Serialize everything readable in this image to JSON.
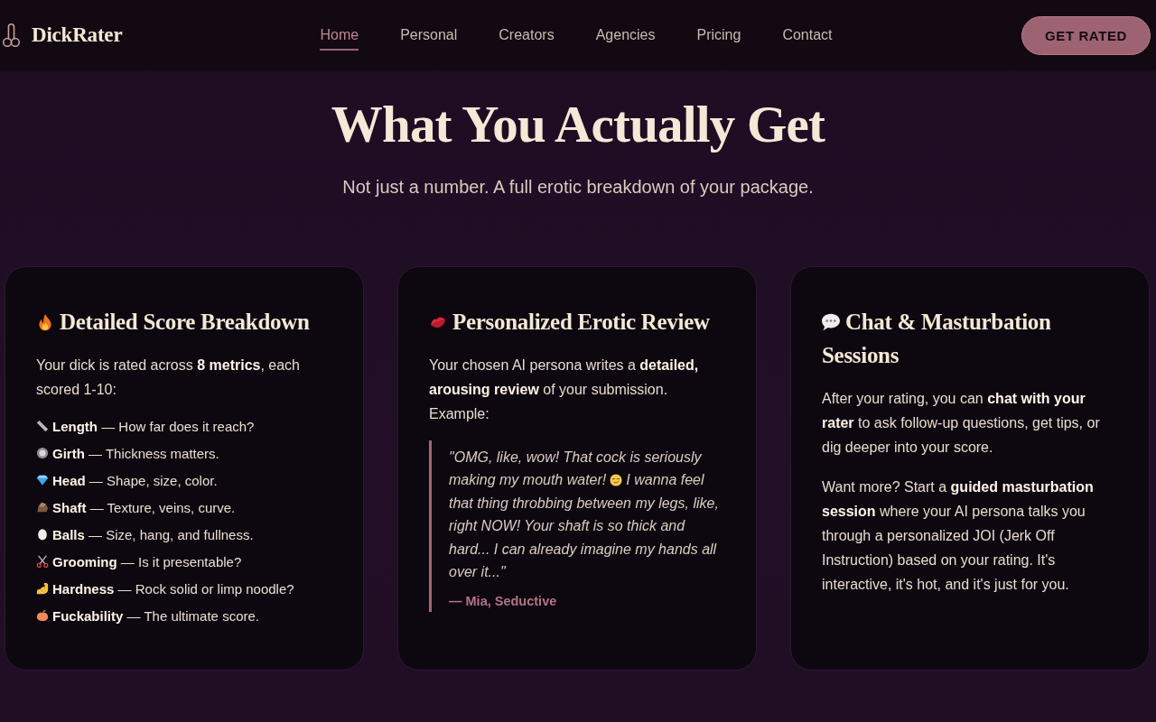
{
  "header": {
    "logo": "DickRater",
    "nav": [
      {
        "label": "Home",
        "selected": true
      },
      {
        "label": "Personal",
        "selected": false
      },
      {
        "label": "Creators",
        "selected": false
      },
      {
        "label": "Agencies",
        "selected": false
      },
      {
        "label": "Pricing",
        "selected": false
      },
      {
        "label": "Contact",
        "selected": false
      }
    ],
    "cta": "GET RATED"
  },
  "hero": {
    "title": "What You Actually Get",
    "subtitle": "Not just a number. A full erotic breakdown of your package."
  },
  "cards": [
    {
      "kind": "metrics",
      "title": "Detailed Score Breakdown",
      "intro": "Your dick is rated across **8 metrics**, each scored 1-10:",
      "metrics": [
        "**Length** — How far does it reach?",
        "**Girth** — Thickness matters.",
        "**Head** — Shape, size, color.",
        "**Shaft** — Texture, veins, curve.",
        "**Balls** — Size, hang, and fullness.",
        "**Grooming** — Is it presentable?",
        "**Hardness** — Rock solid or limp noodle?",
        "**Fuckability** — The ultimate score."
      ]
    },
    {
      "kind": "review",
      "title": "Personalized Erotic Review",
      "intro": "Your chosen AI persona writes a **detailed, arousing review** of your submission. Example:",
      "quote": {
        "text_before": "\"OMG, like, wow! That cock is seriously making my mouth water!",
        "text_after": "I wanna feel that thing throbbing between my legs, like, right NOW! Your shaft is so thick and hard... I can already imagine my hands all over it...\""
      },
      "attribution": "— Mia, Seductive"
    },
    {
      "kind": "text",
      "title": "Chat & Masturbation Sessions",
      "paragraphs": [
        "After your rating, you can **chat with your rater** to ask follow-up questions, get tips, or dig deeper into your score.",
        "Want more? Start a **guided masturbation session** where your AI persona talks you through a personalized JOI (Jerk Off Instruction) based on your rating. It's interactive, it's hot, and it's just for you."
      ]
    }
  ]
}
